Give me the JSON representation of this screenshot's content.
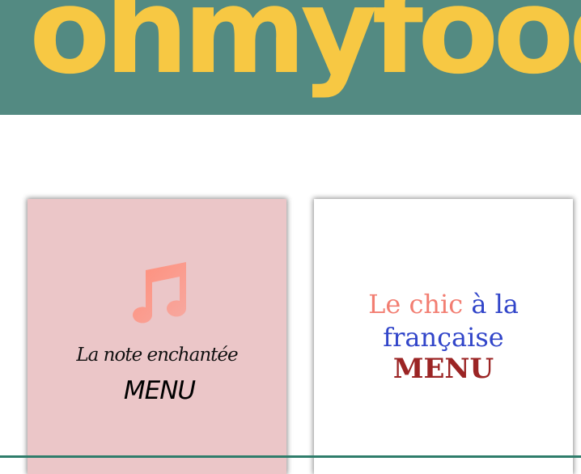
{
  "header": {
    "logo_text": "ohmyfood",
    "background_color": "#538a82",
    "logo_color": "#f7c843"
  },
  "cards": [
    {
      "icon": "music-note-icon",
      "title": "La note enchantée",
      "menu_label": "MENU",
      "background_color": "#ebc6c8"
    },
    {
      "title_part1": "Le chic",
      "title_part2": "à la",
      "title_part3": "française",
      "menu_label": "MENU",
      "background_color": "#ffffff",
      "accent_colors": [
        "#f27e72",
        "#3145c9",
        "#9b2424"
      ]
    }
  ]
}
